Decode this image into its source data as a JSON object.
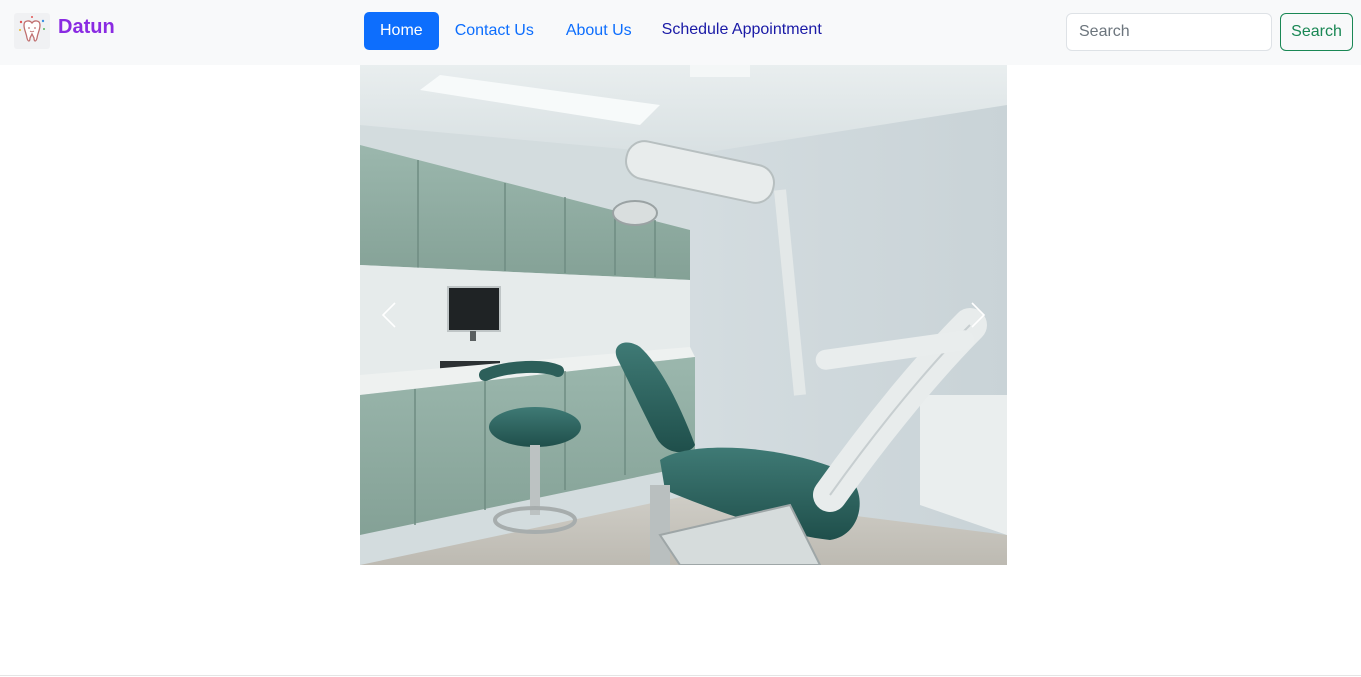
{
  "navbar": {
    "brand_name": "Datun",
    "brand_logo_icon": "tooth-logo-icon",
    "brand_color": "#8a2be2",
    "links": [
      {
        "label": "Home",
        "active": true
      },
      {
        "label": "Contact Us",
        "active": false
      },
      {
        "label": "About Us",
        "active": false
      },
      {
        "label": "Schedule Appointment",
        "active": false
      }
    ],
    "search": {
      "placeholder": "Search",
      "value": "",
      "button_label": "Search"
    },
    "accent_color": "#0d6efd",
    "search_button_color": "#198754"
  },
  "carousel": {
    "image_alt": "",
    "prev_icon": "chevron-left-icon",
    "next_icon": "chevron-right-icon"
  }
}
